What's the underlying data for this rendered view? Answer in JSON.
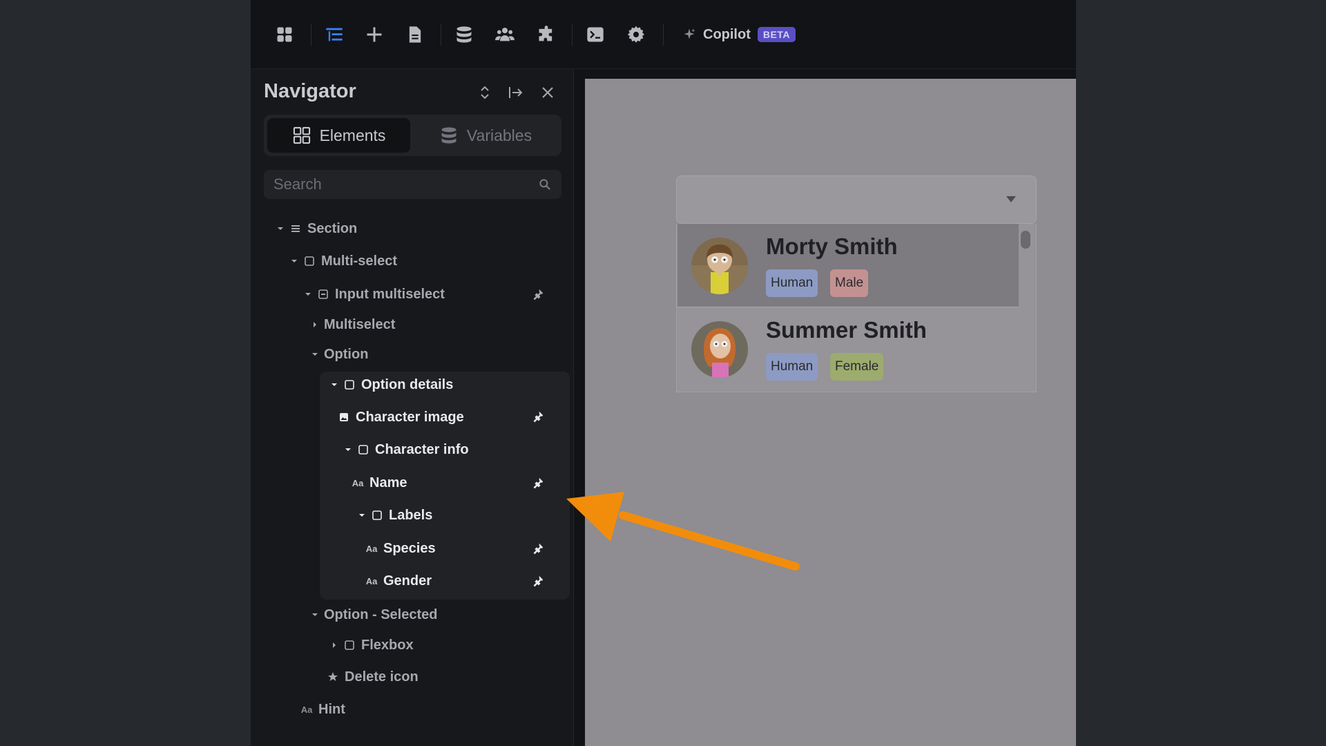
{
  "toolbar": {
    "icons": [
      "apps-icon",
      "navigator-icon",
      "add-icon",
      "pages-icon",
      "database-icon",
      "users-icon",
      "plugins-icon",
      "terminal-icon",
      "settings-icon"
    ],
    "copilot_label": "Copilot",
    "beta_label": "BETA"
  },
  "navigator": {
    "title": "Navigator",
    "tabs": [
      {
        "label": "Elements",
        "active": true
      },
      {
        "label": "Variables",
        "active": false
      }
    ],
    "search_placeholder": "Search",
    "tree": [
      {
        "label": "Section",
        "depth": 0,
        "expanded": true,
        "icon": "section-icon",
        "plug": false
      },
      {
        "label": "Multi-select",
        "depth": 1,
        "expanded": true,
        "icon": "box-icon",
        "plug": false
      },
      {
        "label": "Input multiselect",
        "depth": 2,
        "expanded": true,
        "icon": "input-icon",
        "plug": true
      },
      {
        "label": "Multiselect",
        "depth": 3,
        "expanded": false,
        "icon": "",
        "plug": false
      },
      {
        "label": "Option",
        "depth": 3,
        "expanded": true,
        "icon": "",
        "plug": false
      },
      {
        "label": "Option details",
        "depth": 4,
        "expanded": true,
        "icon": "box-icon",
        "plug": false,
        "highlighted": true
      },
      {
        "label": "Character image",
        "depth": 4,
        "expanded": null,
        "icon": "image-icon",
        "plug": true,
        "highlighted": true
      },
      {
        "label": "Character info",
        "depth": 5,
        "expanded": true,
        "icon": "box-icon",
        "plug": false,
        "highlighted": true
      },
      {
        "label": "Name",
        "depth": 5,
        "expanded": null,
        "icon": "text-icon",
        "plug": true,
        "highlighted": true
      },
      {
        "label": "Labels",
        "depth": 6,
        "expanded": true,
        "icon": "box-icon",
        "plug": false,
        "highlighted": true
      },
      {
        "label": "Species",
        "depth": 6,
        "expanded": null,
        "icon": "text-icon",
        "plug": true,
        "highlighted": true
      },
      {
        "label": "Gender",
        "depth": 6,
        "expanded": null,
        "icon": "text-icon",
        "plug": true,
        "highlighted": true
      },
      {
        "label": "Option - Selected",
        "depth": 3,
        "expanded": true,
        "icon": "",
        "plug": false
      },
      {
        "label": "Flexbox",
        "depth": 4,
        "expanded": false,
        "icon": "box-icon",
        "plug": false
      },
      {
        "label": "Delete icon",
        "depth": 4,
        "expanded": null,
        "icon": "star-icon",
        "plug": false
      },
      {
        "label": "Hint",
        "depth": 1,
        "expanded": null,
        "icon": "text-icon",
        "plug": false
      }
    ]
  },
  "canvas": {
    "options": [
      {
        "name": "Morty Smith",
        "species": "Human",
        "gender": "Male",
        "selected": true
      },
      {
        "name": "Summer Smith",
        "species": "Human",
        "gender": "Female",
        "selected": false
      }
    ],
    "colors": {
      "human_badge": "#8d9bc4",
      "male_badge": "#c49191",
      "female_badge": "#9dab6e",
      "arrow": "#f28d0c"
    }
  }
}
